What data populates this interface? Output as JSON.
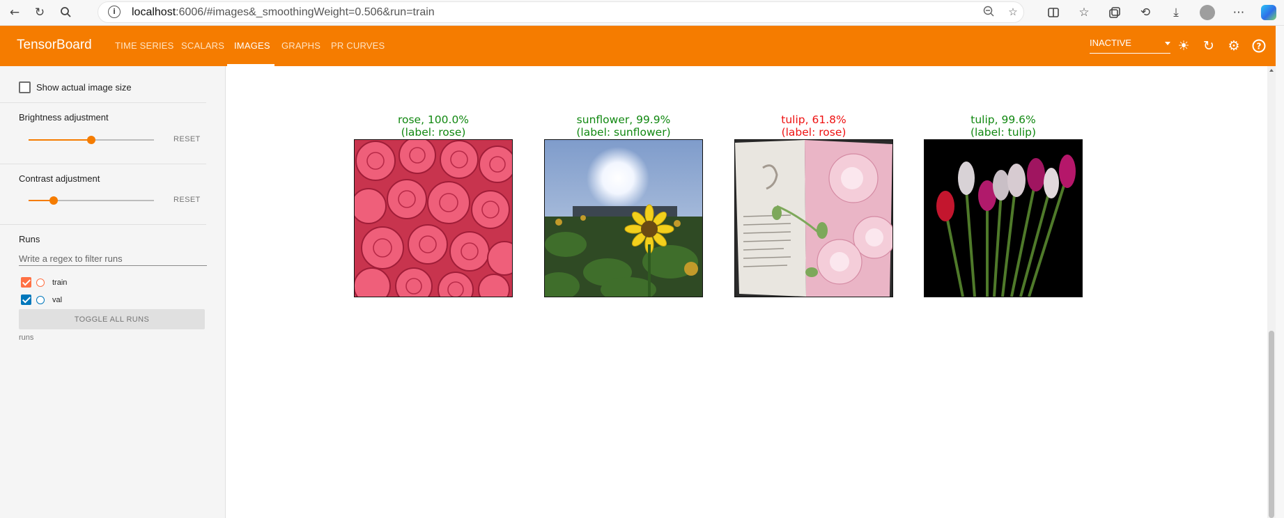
{
  "browser": {
    "url_host": "localhost",
    "url_rest": ":6006/#images&_smoothingWeight=0.506&run=train",
    "icons": [
      "back-icon",
      "reload-icon",
      "search-icon",
      "info-icon",
      "zoom-out-icon",
      "favorite-star-icon",
      "split-screen-icon",
      "favorites-icon",
      "collections-icon",
      "history-icon",
      "download-icon",
      "profile-icon",
      "more-icon",
      "copilot-icon"
    ]
  },
  "header": {
    "brand": "TensorBoard",
    "tabs": [
      {
        "label": "TIME SERIES",
        "active": false
      },
      {
        "label": "SCALARS",
        "active": false
      },
      {
        "label": "IMAGES",
        "active": true
      },
      {
        "label": "GRAPHS",
        "active": false
      },
      {
        "label": "PR CURVES",
        "active": false
      }
    ],
    "status_select": "INACTIVE",
    "accent_color": "#f57c00"
  },
  "sidebar": {
    "show_actual_size_label": "Show actual image size",
    "show_actual_size_checked": false,
    "brightness": {
      "title": "Brightness adjustment",
      "value": 0.5,
      "reset": "RESET"
    },
    "contrast": {
      "title": "Contrast adjustment",
      "value": 0.2,
      "reset": "RESET"
    },
    "runs": {
      "title": "Runs",
      "filter_placeholder": "Write a regex to filter runs",
      "items": [
        {
          "label": "train",
          "checked": true,
          "color": "#ff7043"
        },
        {
          "label": "val",
          "checked": true,
          "color": "#0077bb"
        }
      ],
      "toggle_label": "TOGGLE ALL RUNS",
      "footer": "runs"
    }
  },
  "images": [
    {
      "line1": "rose, 100.0%",
      "line2": "(label: rose)",
      "correct": true,
      "subject": "rose"
    },
    {
      "line1": "sunflower, 99.9%",
      "line2": "(label: sunflower)",
      "correct": true,
      "subject": "sunflower"
    },
    {
      "line1": "tulip, 61.8%",
      "line2": "(label: rose)",
      "correct": false,
      "subject": "pink-flower-book"
    },
    {
      "line1": "tulip, 99.6%",
      "line2": "(label: tulip)",
      "correct": true,
      "subject": "tulip"
    }
  ]
}
